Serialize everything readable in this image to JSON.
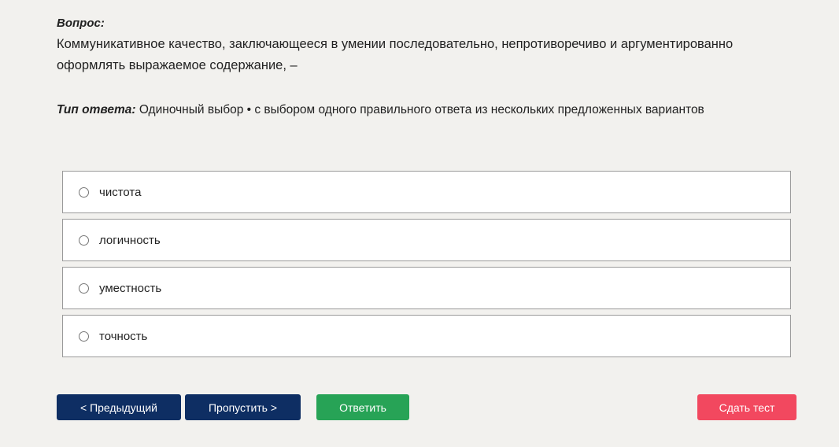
{
  "question": {
    "label": "Вопрос:",
    "text": "Коммуникативное качество, заключающееся в умении последовательно, непротиворечиво и аргументированно оформлять выражаемое содержание, –"
  },
  "answer_type": {
    "label": "Тип ответа:",
    "value": "Одиночный выбор • с выбором одного правильного ответа из нескольких предложенных вариантов"
  },
  "options": [
    {
      "label": "чистота",
      "selected": false
    },
    {
      "label": "логичность",
      "selected": false
    },
    {
      "label": "уместность",
      "selected": false
    },
    {
      "label": "точность",
      "selected": false
    }
  ],
  "buttons": {
    "prev": "< Предыдущий",
    "skip": "Пропустить >",
    "answer": "Ответить",
    "submit": "Сдать тест"
  },
  "colors": {
    "primary": "#0e2e63",
    "success": "#27a356",
    "danger": "#f2485f",
    "background": "#f2f1ee"
  }
}
